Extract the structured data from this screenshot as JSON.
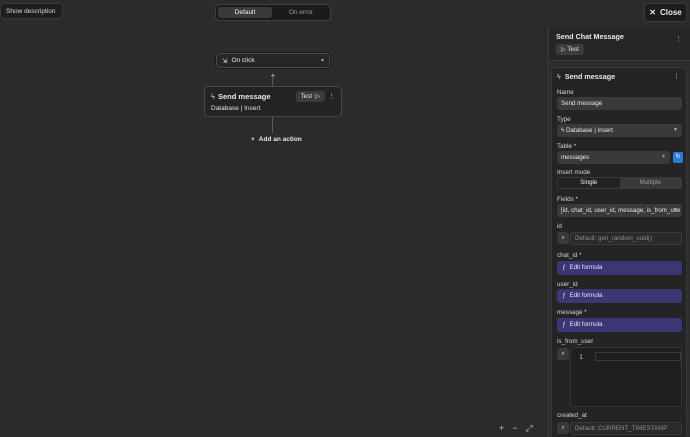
{
  "canvas": {
    "show_description": "Show description",
    "tabs": [
      {
        "label": "Default",
        "active": true
      },
      {
        "label": "On error",
        "active": false
      }
    ],
    "trigger": {
      "label": "On click"
    },
    "node": {
      "title": "Send message",
      "subtitle": "Database | Insert",
      "test_label": "Test"
    },
    "add_action": "Add an action",
    "zoom_controls": [
      "+",
      "−",
      "⤢"
    ]
  },
  "close_button": "Close",
  "panel": {
    "header_title": "Send Chat Message",
    "header_test": "Test",
    "card_title": "Send message",
    "name_label": "Name",
    "name_value": "Send message",
    "type_label": "Type",
    "type_value": "Database | Insert",
    "table_label": "Table *",
    "table_value": "messages",
    "insert_mode_label": "Insert mode",
    "insert_modes": [
      {
        "label": "Single",
        "active": true
      },
      {
        "label": "Multiple",
        "active": false
      }
    ],
    "fields_label": "Fields *",
    "fields_value": "[id, chat_id, user_id, message, is_from_use",
    "id_label": "id",
    "id_placeholder": "Default: gen_random_uuid()",
    "chat_id_label": "chat_id *",
    "user_id_label": "user_id",
    "message_label": "message *",
    "edit_formula": "Edit formula",
    "is_from_user_label": "is_from_user",
    "code_line": "1",
    "created_at_label": "created_at",
    "created_at_placeholder": "Default: CURRENT_TIMESTAMP"
  },
  "colors": {
    "accent": "#2f7ad8",
    "formula": "#3b3774",
    "background": "#2b2b2b"
  }
}
